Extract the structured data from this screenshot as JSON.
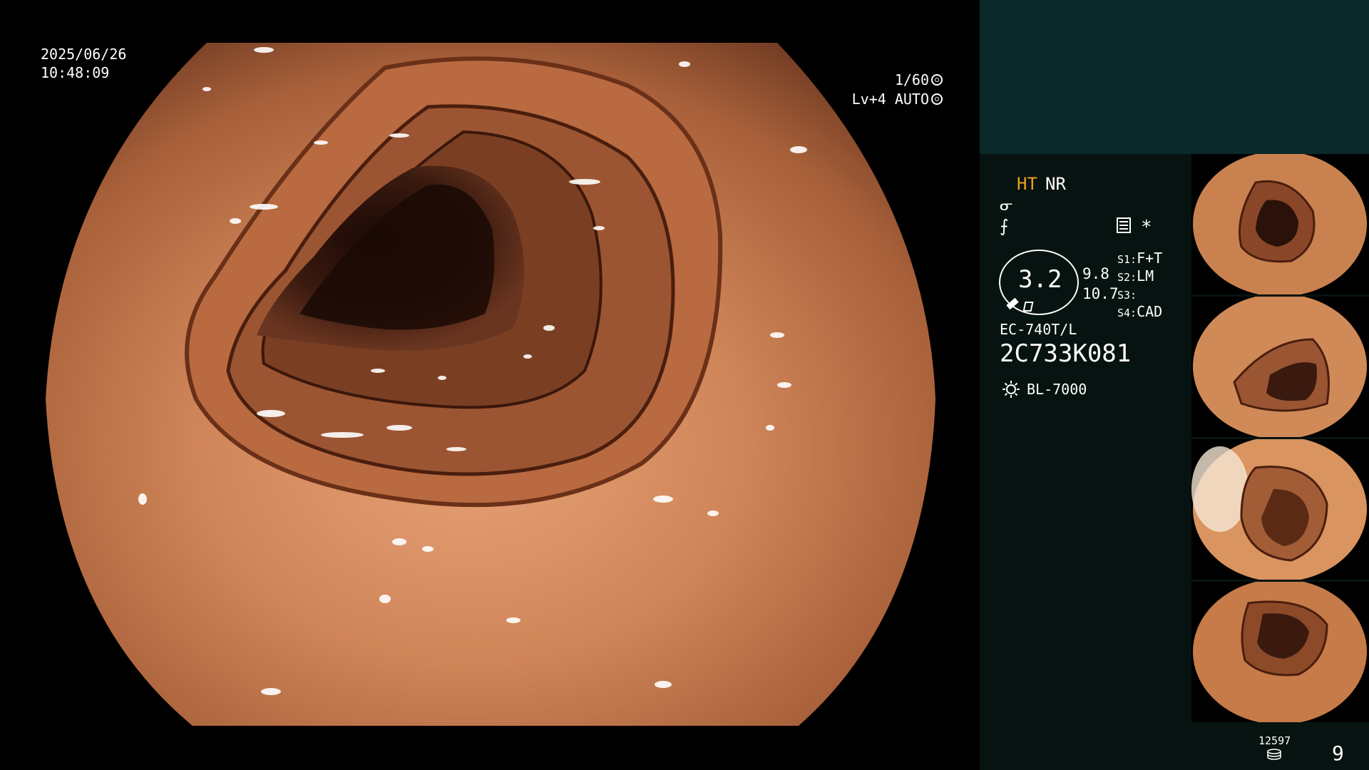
{
  "overlay": {
    "date": "2025/06/26",
    "time": "10:48:09",
    "shutter": "1/60",
    "exposure": "Lv+4 AUTO"
  },
  "panel": {
    "mode_ht": "HT",
    "mode_nr": "NR",
    "gauge_value": "3.2",
    "gauge_side_1": "9.8",
    "gauge_side_2": "10.7",
    "switches": [
      {
        "key": "S1:",
        "value": "F+T"
      },
      {
        "key": "S2:",
        "value": "LM"
      },
      {
        "key": "S3:",
        "value": ""
      },
      {
        "key": "S4:",
        "value": "CAD"
      }
    ],
    "scope_model": "EC-740T/L",
    "scope_serial": "2C733K081",
    "light_source": "BL-7000"
  },
  "footer": {
    "image_count": "12597",
    "page_number": "9"
  },
  "thumbnails": 4,
  "colors": {
    "panel_bg": "#061311",
    "panel_top": "#0a2a2a",
    "mucosa": "#c8774a",
    "ht_accent": "#f0a020"
  }
}
